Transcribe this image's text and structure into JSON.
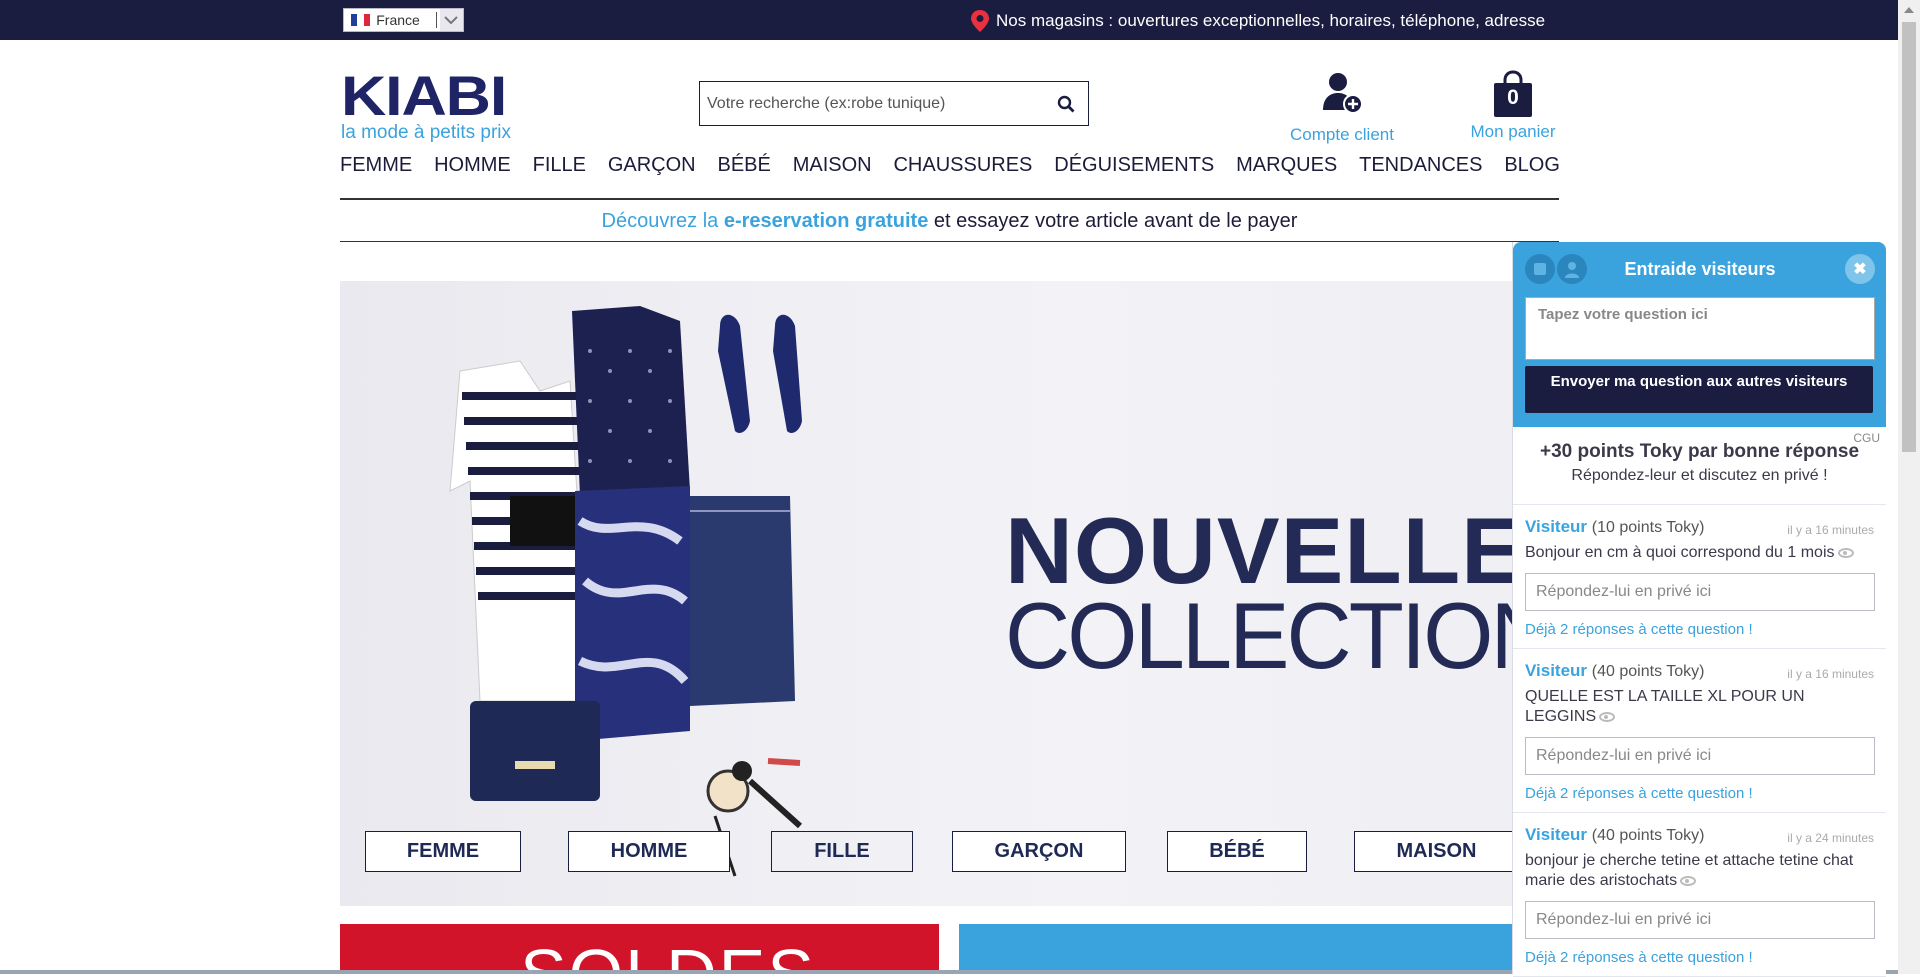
{
  "topbar": {
    "language": "France",
    "stores_text": "Nos magasins : ouvertures exceptionnelles, horaires, téléphone, adresse"
  },
  "header": {
    "logo_word": "KIABI",
    "logo_tagline": "la mode à petits prix",
    "search_placeholder": "Votre recherche (ex:robe tunique)",
    "account_label": "Compte client",
    "cart_label": "Mon panier",
    "cart_count": "0"
  },
  "nav": {
    "items": [
      "FEMME",
      "HOMME",
      "FILLE",
      "GARÇON",
      "BÉBÉ",
      "MAISON",
      "CHAUSSURES",
      "DÉGUISEMENTS",
      "MARQUES",
      "TENDANCES",
      "BLOG"
    ]
  },
  "promo": {
    "prefix": "Découvrez la ",
    "highlight": "e-reservation gratuite",
    "suffix": " et essayez votre article avant de le payer"
  },
  "hero": {
    "title_line1": "NOUVELLE",
    "title_line2": "COLLECTION",
    "categories": [
      "FEMME",
      "HOMME",
      "FILLE",
      "GARÇON",
      "BÉBÉ",
      "MAISON"
    ]
  },
  "tiles": {
    "red_text": "SOLDES"
  },
  "chat": {
    "title": "Entraide visiteurs",
    "question_placeholder": "Tapez votre question ici",
    "send_label": "Envoyer ma question aux autres visiteurs",
    "points_text": "+30 points Toky par bonne réponse",
    "points_sub": "Répondez-leur et discutez en privé !",
    "cgu": "CGU",
    "messages": [
      {
        "user": "Visiteur",
        "points": "(10 points Toky)",
        "time": "il y a 16 minutes",
        "text": "Bonjour en cm à quoi correspond du 1 mois",
        "reply_placeholder": "Répondez-lui en privé ici",
        "answers": "Déjà 2 réponses à cette question !"
      },
      {
        "user": "Visiteur",
        "points": "(40 points Toky)",
        "time": "il y a 16 minutes",
        "text": "QUELLE EST LA TAILLE XL POUR UN LEGGINS",
        "reply_placeholder": "Répondez-lui en privé ici",
        "answers": "Déjà 2 réponses à cette question !"
      },
      {
        "user": "Visiteur",
        "points": "(40 points Toky)",
        "time": "il y a 24 minutes",
        "text": "bonjour je cherche tetine et attache tetine chat marie des aristochats",
        "reply_placeholder": "Répondez-lui en privé ici",
        "answers": "Déjà 2 réponses à cette question !"
      }
    ]
  },
  "colors": {
    "navy": "#1a1c40",
    "brand_blue": "#3aa3de",
    "sale_red": "#d2142a"
  }
}
